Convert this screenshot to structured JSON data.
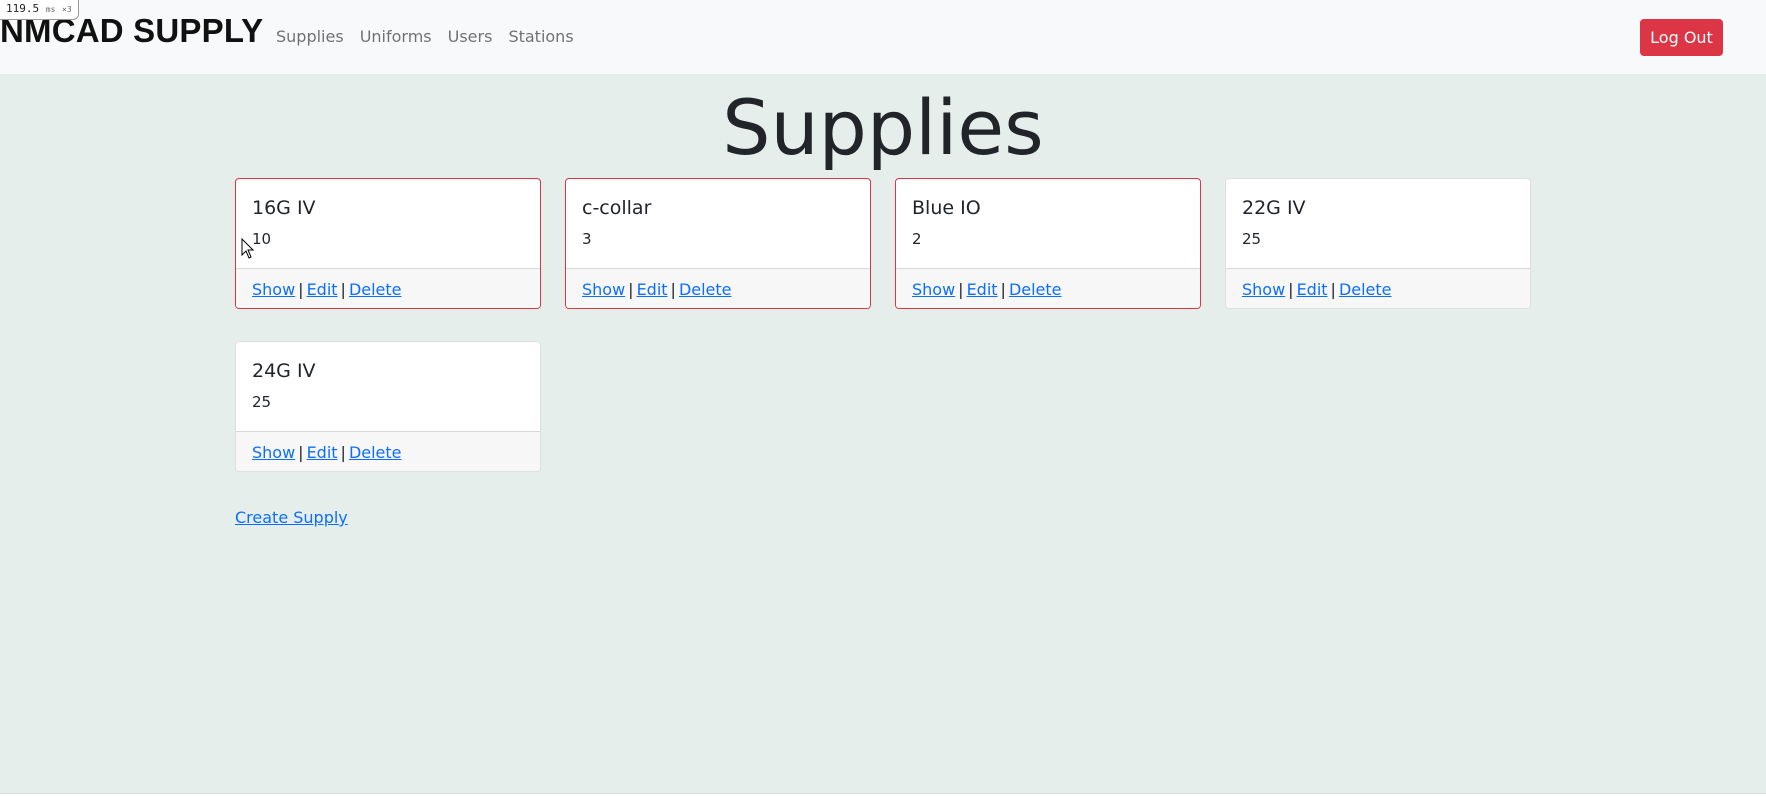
{
  "perf": {
    "value": "119.5",
    "unit": "ms",
    "mult": "×3"
  },
  "navbar": {
    "brand": "NMCAD SUPPLY",
    "links": [
      "Supplies",
      "Uniforms",
      "Users",
      "Stations"
    ],
    "logout_label": "Log Out"
  },
  "page": {
    "title": "Supplies",
    "create_label": "Create Supply"
  },
  "actions": {
    "show": "Show",
    "edit": "Edit",
    "delete": "Delete",
    "separator": "|"
  },
  "supplies": [
    {
      "name": "16G IV",
      "quantity": "10",
      "low_stock": true
    },
    {
      "name": "c-collar",
      "quantity": "3",
      "low_stock": true
    },
    {
      "name": "Blue IO",
      "quantity": "2",
      "low_stock": true
    },
    {
      "name": "22G IV",
      "quantity": "25",
      "low_stock": false
    },
    {
      "name": "24G IV",
      "quantity": "25",
      "low_stock": false
    }
  ],
  "colors": {
    "danger": "#dc3545",
    "link": "#0d6efd",
    "page_bg": "#e6eeeb",
    "navbar_bg": "#f8f9fa"
  }
}
